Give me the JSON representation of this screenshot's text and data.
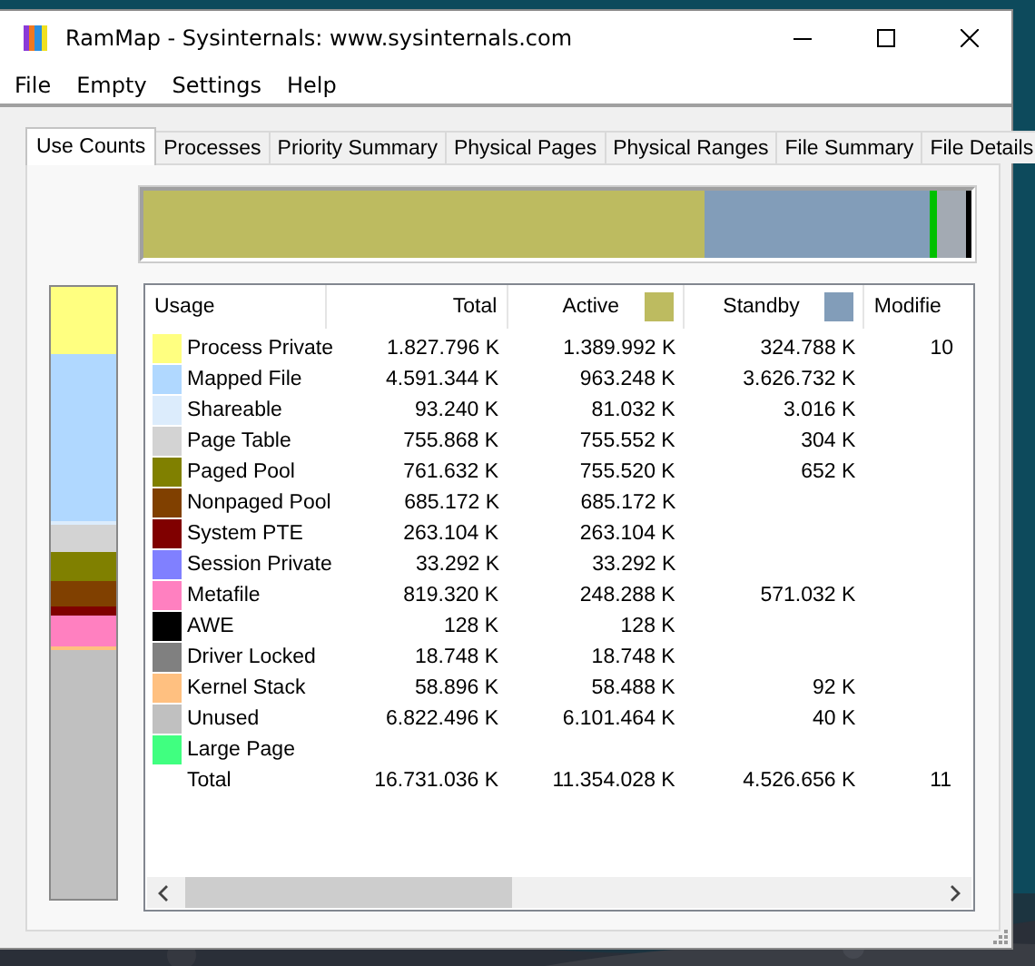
{
  "window": {
    "title": "RamMap - Sysinternals: www.sysinternals.com"
  },
  "menu": [
    "File",
    "Empty",
    "Settings",
    "Help"
  ],
  "tabs": [
    {
      "label": "Use Counts",
      "selected": true
    },
    {
      "label": "Processes",
      "selected": false
    },
    {
      "label": "Priority Summary",
      "selected": false
    },
    {
      "label": "Physical Pages",
      "selected": false
    },
    {
      "label": "Physical Ranges",
      "selected": false
    },
    {
      "label": "File Summary",
      "selected": false
    },
    {
      "label": "File Details",
      "selected": false
    }
  ],
  "state_bar": {
    "segments": [
      {
        "color": "#bdbb60"
      },
      {
        "color": "#829db9"
      },
      {
        "color": "#00c000"
      },
      {
        "color": "#a3aab3"
      },
      {
        "color": "#000000"
      }
    ]
  },
  "table": {
    "columns": [
      {
        "label": "Usage"
      },
      {
        "label": "Total"
      },
      {
        "label": "Active",
        "color": "#bdbb60"
      },
      {
        "label": "Standby",
        "color": "#829db9"
      },
      {
        "label": "Modifie"
      }
    ],
    "rows": [
      {
        "usage": "Process Private",
        "color": "#ffff80",
        "total": "1.827.796 K",
        "active": "1.389.992 K",
        "standby": "324.788 K",
        "column_5": "10"
      },
      {
        "usage": "Mapped File",
        "color": "#b0d8ff",
        "total": "4.591.344 K",
        "active": "963.248 K",
        "standby": "3.626.732 K"
      },
      {
        "usage": "Shareable",
        "color": "#dcecfc",
        "total": "93.240 K",
        "active": "81.032 K",
        "standby": "3.016 K"
      },
      {
        "usage": "Page Table",
        "color": "#d3d3d3",
        "total": "755.868 K",
        "active": "755.552 K",
        "standby": "304 K"
      },
      {
        "usage": "Paged Pool",
        "color": "#808000",
        "total": "761.632 K",
        "active": "755.520 K",
        "standby": "652 K"
      },
      {
        "usage": "Nonpaged Pool",
        "color": "#804000",
        "total": "685.172 K",
        "active": "685.172 K"
      },
      {
        "usage": "System PTE",
        "color": "#800000",
        "total": "263.104 K",
        "active": "263.104 K"
      },
      {
        "usage": "Session Private",
        "color": "#8080ff",
        "total": "33.292 K",
        "active": "33.292 K"
      },
      {
        "usage": "Metafile",
        "color": "#ff80c0",
        "total": "819.320 K",
        "active": "248.288 K",
        "standby": "571.032 K"
      },
      {
        "usage": "AWE",
        "color": "#000000",
        "total": "128 K",
        "active": "128 K"
      },
      {
        "usage": "Driver Locked",
        "color": "#808080",
        "total": "18.748 K",
        "active": "18.748 K"
      },
      {
        "usage": "Kernel Stack",
        "color": "#ffc080",
        "total": "58.896 K",
        "active": "58.488 K",
        "standby": "92 K"
      },
      {
        "usage": "Unused",
        "color": "#c0c0c0",
        "total": "6.822.496 K",
        "active": "6.101.464 K",
        "standby": "40 K"
      },
      {
        "usage": "Large Page",
        "color": "#40ff80"
      }
    ],
    "total_row": {
      "usage": "Total",
      "total": "16.731.036 K",
      "active": "11.354.028 K",
      "standby": "4.526.656 K",
      "column_5": "11"
    }
  }
}
